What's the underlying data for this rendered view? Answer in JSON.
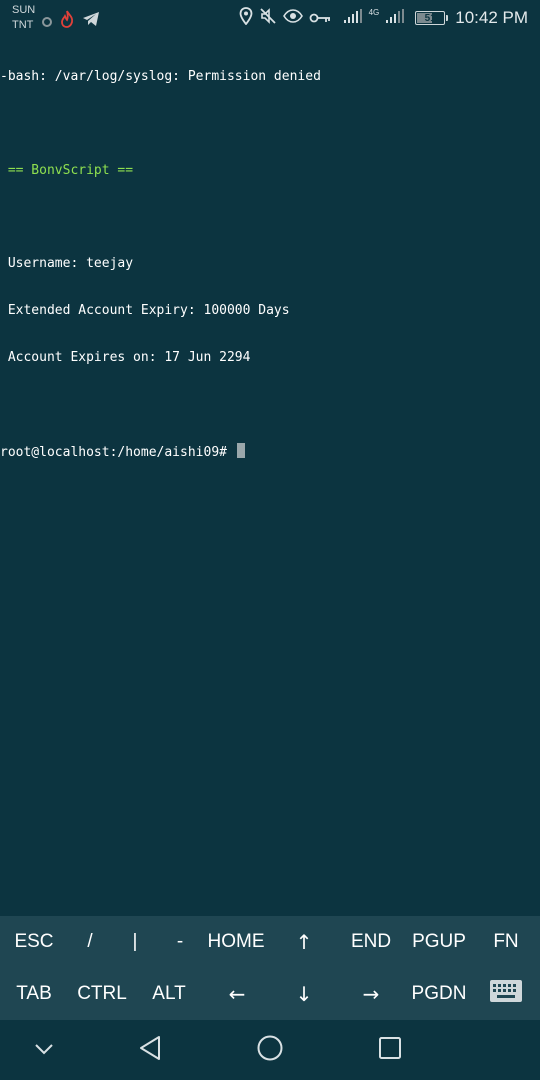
{
  "status_bar": {
    "carrier_line1": "SUN",
    "carrier_line2": "TNT",
    "network_type": "4G",
    "battery_level": "51",
    "time": "10:42 PM"
  },
  "terminal": {
    "lines": [
      "-bash: /var/log/syslog: Permission denied",
      "",
      " == BonvScript ==",
      "",
      " Username: teejay",
      " Extended Account Expiry: 100000 Days",
      " Account Expires on: 17 Jun 2294",
      "",
      "root@localhost:/home/aishi09# "
    ]
  },
  "extra_keys": {
    "row1": [
      "ESC",
      "/",
      "|",
      "-",
      "HOME",
      "↑",
      "END",
      "PGUP",
      "FN"
    ],
    "row2": [
      "TAB",
      "CTRL",
      "ALT",
      "←",
      "↓",
      "→",
      "PGDN"
    ]
  },
  "colors": {
    "background": "#0c3440",
    "keys_background": "#1f4652",
    "banner_green": "#8fe04f",
    "text": "#ffffff"
  }
}
